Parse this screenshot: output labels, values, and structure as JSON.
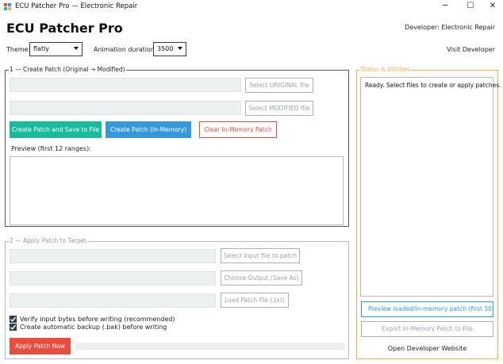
{
  "window": {
    "title": "ECU Patcher Pro — Electronic Repair",
    "minimize": "─",
    "maximize": "☐",
    "close": "✕"
  },
  "header": {
    "app_title": "ECU Patcher Pro",
    "developer": "Developer: Electronic Repair",
    "visit_link": "Visit Developer"
  },
  "settings": {
    "theme_label": "Theme:",
    "theme_value": "flatly",
    "animation_label": "Animation duration:",
    "animation_value": "3500"
  },
  "create": {
    "legend": "1 — Create Patch (Original → Modified)",
    "select_original": "Select ORIGINAL file",
    "select_modified": "Select MODIFIED file",
    "create_save": "Create Patch and Save to File",
    "create_memory": "Create Patch (In-Memory)",
    "clear_memory": "Clear In-Memory Patch",
    "preview_label": "Preview (first 12 ranges):"
  },
  "apply": {
    "legend": "2 — Apply Patch to Target",
    "select_input": "Select Input file to patch",
    "choose_output": "Choose Output (Save As)",
    "load_patch": "Load Patch file (.txt)",
    "verify_label": "Verify input bytes before writing (recommended)",
    "verify_checked": true,
    "backup_label": "Create automatic backup (.bak) before writing",
    "backup_checked": true,
    "apply_button": "Apply Patch Now",
    "progress": 0
  },
  "status": {
    "legend": "Status & Utilities",
    "message": "Ready. Select files to create or apply patches.",
    "preview_button": "Preview loaded/in-memory patch (first 30 r",
    "export_button": "Export In-Memory Patch to File",
    "open_website": "Open Developer Website"
  },
  "colors": {
    "accent_teal": "#18bc9c",
    "accent_blue": "#3498db",
    "danger_red": "#e74c3c",
    "warning_orange": "#f0ad4e",
    "dark": "#2c3e50"
  }
}
